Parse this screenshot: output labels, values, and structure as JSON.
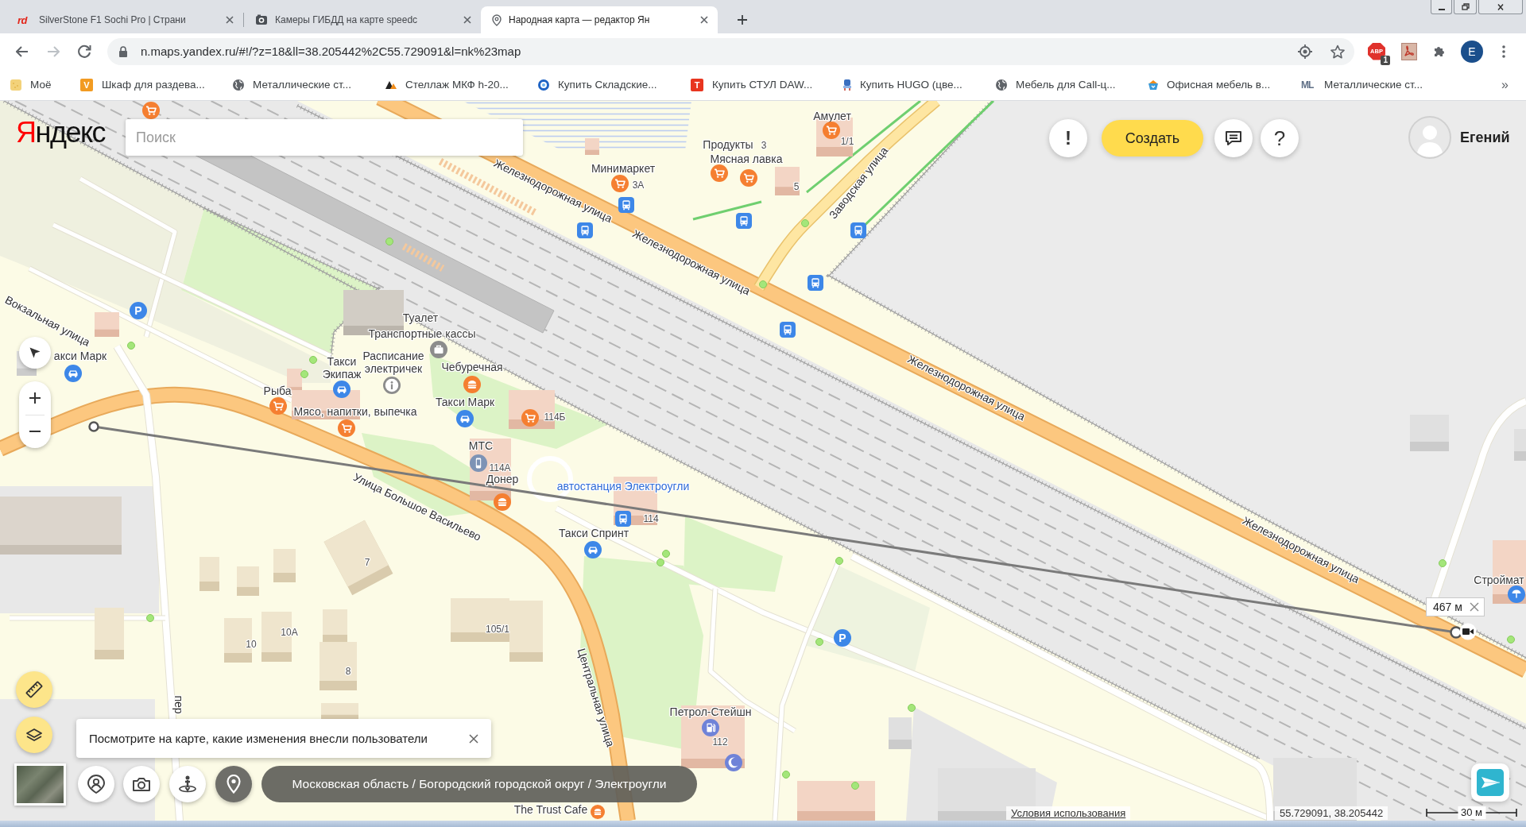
{
  "tabs": [
    {
      "kind": "text",
      "icon_text": "rd",
      "title": "SilverStone F1 Sochi Pro | Страни",
      "selected": false
    },
    {
      "kind": "camera",
      "title": "Камеры ГИБДД на карте speedc",
      "selected": false
    },
    {
      "kind": "pin",
      "title": "Народная карта — редактор Ян",
      "selected": true
    }
  ],
  "toolbar": {
    "url": "n.maps.yandex.ru/#!/?z=18&ll=38.205442%2C55.729091&l=nk%23map",
    "extensions": [
      {
        "kind": "adblock",
        "label": "ABP",
        "badge": "1"
      },
      {
        "kind": "pdf"
      },
      {
        "kind": "puzzle"
      }
    ],
    "profile_initial": "E"
  },
  "bookmarks": {
    "items": [
      {
        "kind": "tile",
        "label": "Моё"
      },
      {
        "kind": "letter",
        "icon_text": "V",
        "color": "#f29b22",
        "label": "Шкаф для раздева..."
      },
      {
        "kind": "globe",
        "label": "Металлические ст..."
      },
      {
        "kind": "peaks",
        "label": "Стеллаж МКФ h-20..."
      },
      {
        "kind": "ring",
        "label": "Купить Складские..."
      },
      {
        "kind": "letter",
        "icon_text": "T",
        "color": "#e8351f",
        "label": "Купить СТУЛ DAW..."
      },
      {
        "kind": "chair",
        "label": "Купить HUGO (цве..."
      },
      {
        "kind": "globe",
        "label": "Мебель для Call-ц..."
      },
      {
        "kind": "basket",
        "label": "Офисная мебель в..."
      },
      {
        "kind": "monogram",
        "icon_text": "ML",
        "label": "Металлические ст..."
      }
    ],
    "more": "»"
  },
  "map": {
    "logo": "Яндекс",
    "search": {
      "placeholder": "Поиск"
    },
    "alert_button": "!",
    "create_button": "Создать",
    "help_button": "?",
    "user_name": "Егений",
    "labels": [
      {
        "kind": "poi",
        "text": "Амулет"
      },
      {
        "kind": "poi",
        "text": "Продукты"
      },
      {
        "kind": "house",
        "text": "3"
      },
      {
        "kind": "house",
        "text": "1/1"
      },
      {
        "kind": "street",
        "text": "Железнодорожная улица"
      },
      {
        "kind": "poi",
        "text": "Минимаркет"
      },
      {
        "kind": "poi",
        "text": "Мясная лавка"
      },
      {
        "kind": "house",
        "text": "3А"
      },
      {
        "kind": "house",
        "text": "5"
      },
      {
        "kind": "street",
        "text": "Заводская улица"
      },
      {
        "kind": "street",
        "text": "Железнодорожная улица"
      },
      {
        "kind": "street",
        "text": "Вокзальная улица"
      },
      {
        "kind": "poi",
        "text": "Туалет"
      },
      {
        "kind": "poi",
        "text": "Транспортные кассы"
      },
      {
        "kind": "poi",
        "text": "акси Марк"
      },
      {
        "kind": "poi",
        "text": "Такси Экипаж"
      },
      {
        "kind": "poi",
        "text": "Расписание электричек"
      },
      {
        "kind": "poi",
        "text": "Чебуречная"
      },
      {
        "kind": "poi",
        "text": "Рыба"
      },
      {
        "kind": "poi",
        "text": "Мясо, напитки, выпечка"
      },
      {
        "kind": "poi",
        "text": "Такси Марк"
      },
      {
        "kind": "house",
        "text": "114Б"
      },
      {
        "kind": "street",
        "text": "Железнодорожная улица"
      },
      {
        "kind": "poi",
        "text": "МТС"
      },
      {
        "kind": "house",
        "text": "114А"
      },
      {
        "kind": "street",
        "text": "Улица Большое Васильево"
      },
      {
        "kind": "poi",
        "text": "Донер"
      },
      {
        "kind": "transit",
        "text": "автостанция Электроугли"
      },
      {
        "kind": "house",
        "text": "114"
      },
      {
        "kind": "poi",
        "text": "Такси Спринт"
      },
      {
        "kind": "house",
        "text": "7"
      },
      {
        "kind": "street",
        "text": "Железнодорожная улица"
      },
      {
        "kind": "poi",
        "text": "Строймат"
      },
      {
        "kind": "house",
        "text": "10А"
      },
      {
        "kind": "house",
        "text": "105/1"
      },
      {
        "kind": "house",
        "text": "10"
      },
      {
        "kind": "house",
        "text": "8"
      },
      {
        "kind": "street",
        "text": "пер"
      },
      {
        "kind": "street",
        "text": "Центральная улица"
      },
      {
        "kind": "poi",
        "text": "Петрол-Стейшн"
      },
      {
        "kind": "house",
        "text": "112"
      },
      {
        "kind": "poi",
        "text": "The Trust Cafe"
      }
    ],
    "parking_signs": [
      "P",
      "P"
    ],
    "measurement": {
      "distance": "467 м"
    },
    "hint": "Посмотрите на карте, какие изменения внесли пользователи",
    "breadcrumb": "Московская область / Богородский городской округ / Электроугли",
    "terms_link": "Условия использования",
    "coordinates": "55.729091, 38.205442",
    "scale": "30 м"
  }
}
